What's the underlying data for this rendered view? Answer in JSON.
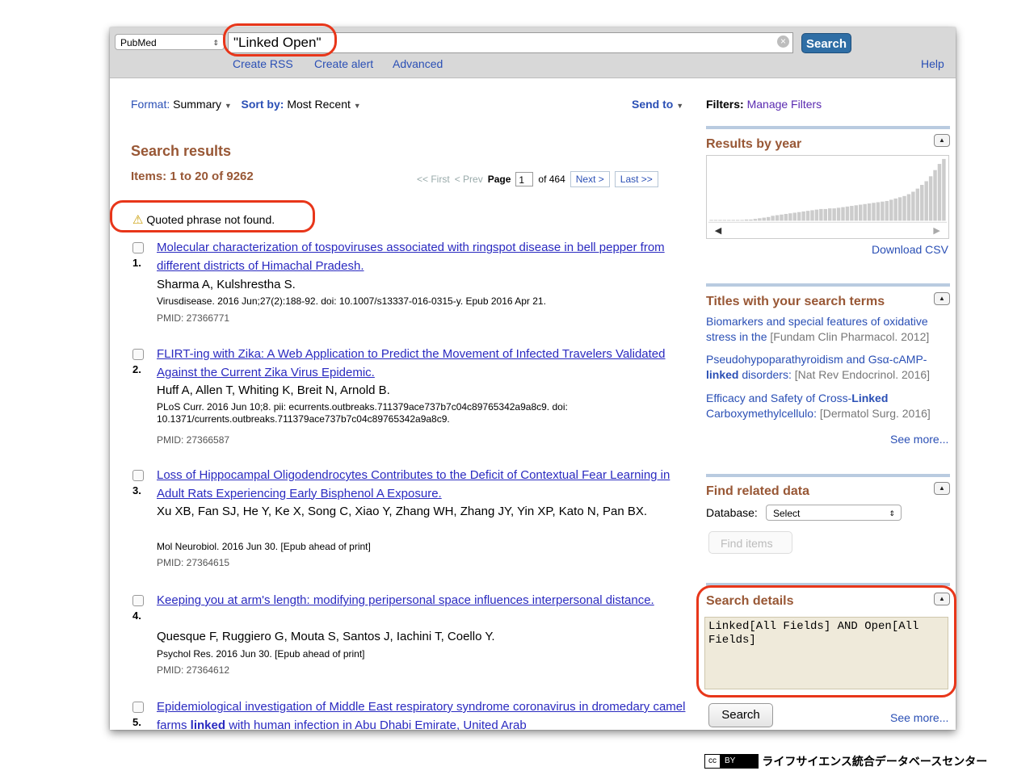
{
  "topbar": {
    "database": "PubMed",
    "query": "\"Linked Open\"",
    "search_label": "Search",
    "links": [
      "Create RSS",
      "Create alert",
      "Advanced"
    ],
    "help": "Help"
  },
  "controls": {
    "format_label": "Format",
    "format_value": "Summary",
    "sort_label": "Sort by",
    "sort_value": "Most Recent",
    "send_to": "Send to"
  },
  "results_header": {
    "title": "Search results",
    "items": "Items: 1 to 20 of 9262",
    "pager": {
      "first": "<< First",
      "prev": "< Prev",
      "page_label": "Page",
      "page": "1",
      "of": "of 464",
      "next": "Next >",
      "last": "Last >>"
    },
    "warning": "Quoted phrase not found."
  },
  "results": [
    {
      "num": "1.",
      "title": "Molecular characterization of tospoviruses associated with ringspot disease in bell pepper from different districts of Himachal Pradesh.",
      "authors": "Sharma A, Kulshrestha S.",
      "citation": "Virusdisease. 2016 Jun;27(2):188-92. doi: 10.1007/s13337-016-0315-y. Epub 2016 Apr 21.",
      "pmid": "PMID: 27366771"
    },
    {
      "num": "2.",
      "title": "FLIRT-ing with Zika: A Web Application to Predict the Movement of Infected Travelers Validated Against the Current Zika Virus Epidemic.",
      "authors": "Huff A, Allen T, Whiting K, Breit N, Arnold B.",
      "citation": "PLoS Curr. 2016 Jun 10;8. pii: ecurrents.outbreaks.711379ace737b7c04c89765342a9a8c9. doi: 10.1371/currents.outbreaks.711379ace737b7c04c89765342a9a8c9.",
      "pmid": "PMID: 27366587"
    },
    {
      "num": "3.",
      "title": "Loss of Hippocampal Oligodendrocytes Contributes to the Deficit of Contextual Fear Learning in Adult Rats Experiencing Early Bisphenol A Exposure.",
      "authors": "Xu XB, Fan SJ, He Y, Ke X, Song C, Xiao Y, Zhang WH, Zhang JY, Yin XP, Kato N, Pan BX.",
      "citation": "Mol Neurobiol. 2016 Jun 30. [Epub ahead of print]",
      "pmid": "PMID: 27364615"
    },
    {
      "num": "4.",
      "title": "Keeping you at arm's length: modifying peripersonal space influences interpersonal distance.",
      "authors": "Quesque F, Ruggiero G, Mouta S, Santos J, Iachini T, Coello Y.",
      "citation": "Psychol Res. 2016 Jun 30. [Epub ahead of print]",
      "pmid": "PMID: 27364612"
    },
    {
      "num": "5.",
      "title_a": "Epidemiological investigation of Middle East respiratory syndrome coronavirus in dromedary camel farms ",
      "title_bold": "linked",
      "title_b": " with human infection in Abu Dhabi Emirate, United Arab"
    }
  ],
  "sidebar": {
    "filters_label": "Filters:",
    "manage_filters": "Manage Filters",
    "results_by_year": "Results by year",
    "download_csv": "Download CSV",
    "year_counts": [
      1,
      1,
      1,
      1,
      1,
      1,
      1,
      1,
      2,
      2,
      3,
      4,
      5,
      6,
      8,
      9,
      10,
      11,
      12,
      13,
      14,
      15,
      16,
      17,
      18,
      19,
      19,
      20,
      20,
      21,
      22,
      23,
      24,
      25,
      26,
      27,
      28,
      29,
      30,
      31,
      32,
      34,
      36,
      38,
      40,
      43,
      47,
      52,
      58,
      64,
      72,
      82,
      92,
      100
    ],
    "titles_heading": "Titles with your search terms",
    "titles": [
      {
        "a": "Biomarkers and special features of oxidative stress in the",
        "bold": "",
        "b": "",
        "src": "[Fundam Clin Pharmacol. 2012]"
      },
      {
        "a": "Pseudohypoparathyroidism and Gsα-cAMP-",
        "bold": "linked",
        "b": " disorders",
        "src": "[Nat Rev Endocrinol. 2016]"
      },
      {
        "a": "Efficacy and Safety of Cross-",
        "bold": "Linked",
        "b": " Carboxymethylcellulo",
        "src": "[Dermatol Surg. 2016]"
      }
    ],
    "see_more": "See more...",
    "related_heading": "Find related data",
    "database_label": "Database:",
    "database_value": "Select",
    "find_items": "Find items",
    "details_heading": "Search details",
    "details_text": "Linked[All Fields] AND Open[All Fields]",
    "details_search": "Search"
  },
  "footer": {
    "cc": "cc",
    "by": "BY",
    "text": "ライフサイエンス統合データベースセンター"
  }
}
